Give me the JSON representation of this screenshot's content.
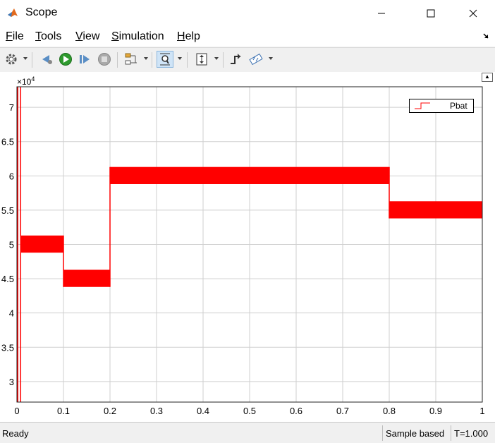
{
  "window": {
    "title": "Scope",
    "minimize_icon": "minimize-icon",
    "maximize_icon": "maximize-icon",
    "close_icon": "close-icon"
  },
  "menu": {
    "items": [
      {
        "label": "File"
      },
      {
        "label": "Tools"
      },
      {
        "label": "View"
      },
      {
        "label": "Simulation"
      },
      {
        "label": "Help"
      }
    ]
  },
  "toolbar": {
    "buttons": [
      "settings-icon",
      "step-back-icon",
      "run-icon",
      "step-forward-icon",
      "stop-icon",
      "signal-tools-icon",
      "zoom-icon",
      "scale-axes-icon",
      "triggers-icon",
      "measurements-icon"
    ]
  },
  "chart_data": {
    "type": "line",
    "exponent_label": "×10",
    "exponent_power": "4",
    "xlim": [
      0,
      1
    ],
    "ylim": [
      2.7,
      7.3
    ],
    "x_ticks": [
      "0",
      "0.1",
      "0.2",
      "0.3",
      "0.4",
      "0.5",
      "0.6",
      "0.7",
      "0.8",
      "0.9",
      "1"
    ],
    "y_ticks": [
      "3",
      "3.5",
      "4",
      "4.5",
      "5",
      "5.5",
      "6",
      "6.5",
      "7"
    ],
    "grid": true,
    "legend_position": "top-right",
    "series": [
      {
        "name": "Pbat",
        "color": "#ff0000",
        "bands": [
          {
            "x": [
              0.0,
              0.003
            ],
            "low": 2.7,
            "high": 7.3
          },
          {
            "x": [
              0.008,
              0.1
            ],
            "low": 4.88,
            "high": 5.13
          },
          {
            "x": [
              0.1,
              0.2
            ],
            "low": 4.38,
            "high": 4.63
          },
          {
            "x": [
              0.2,
              0.8
            ],
            "low": 5.88,
            "high": 6.13
          },
          {
            "x": [
              0.8,
              1.0
            ],
            "low": 5.38,
            "high": 5.63
          }
        ]
      }
    ]
  },
  "status": {
    "ready": "Ready",
    "sample": "Sample based",
    "time": "T=1.000"
  }
}
